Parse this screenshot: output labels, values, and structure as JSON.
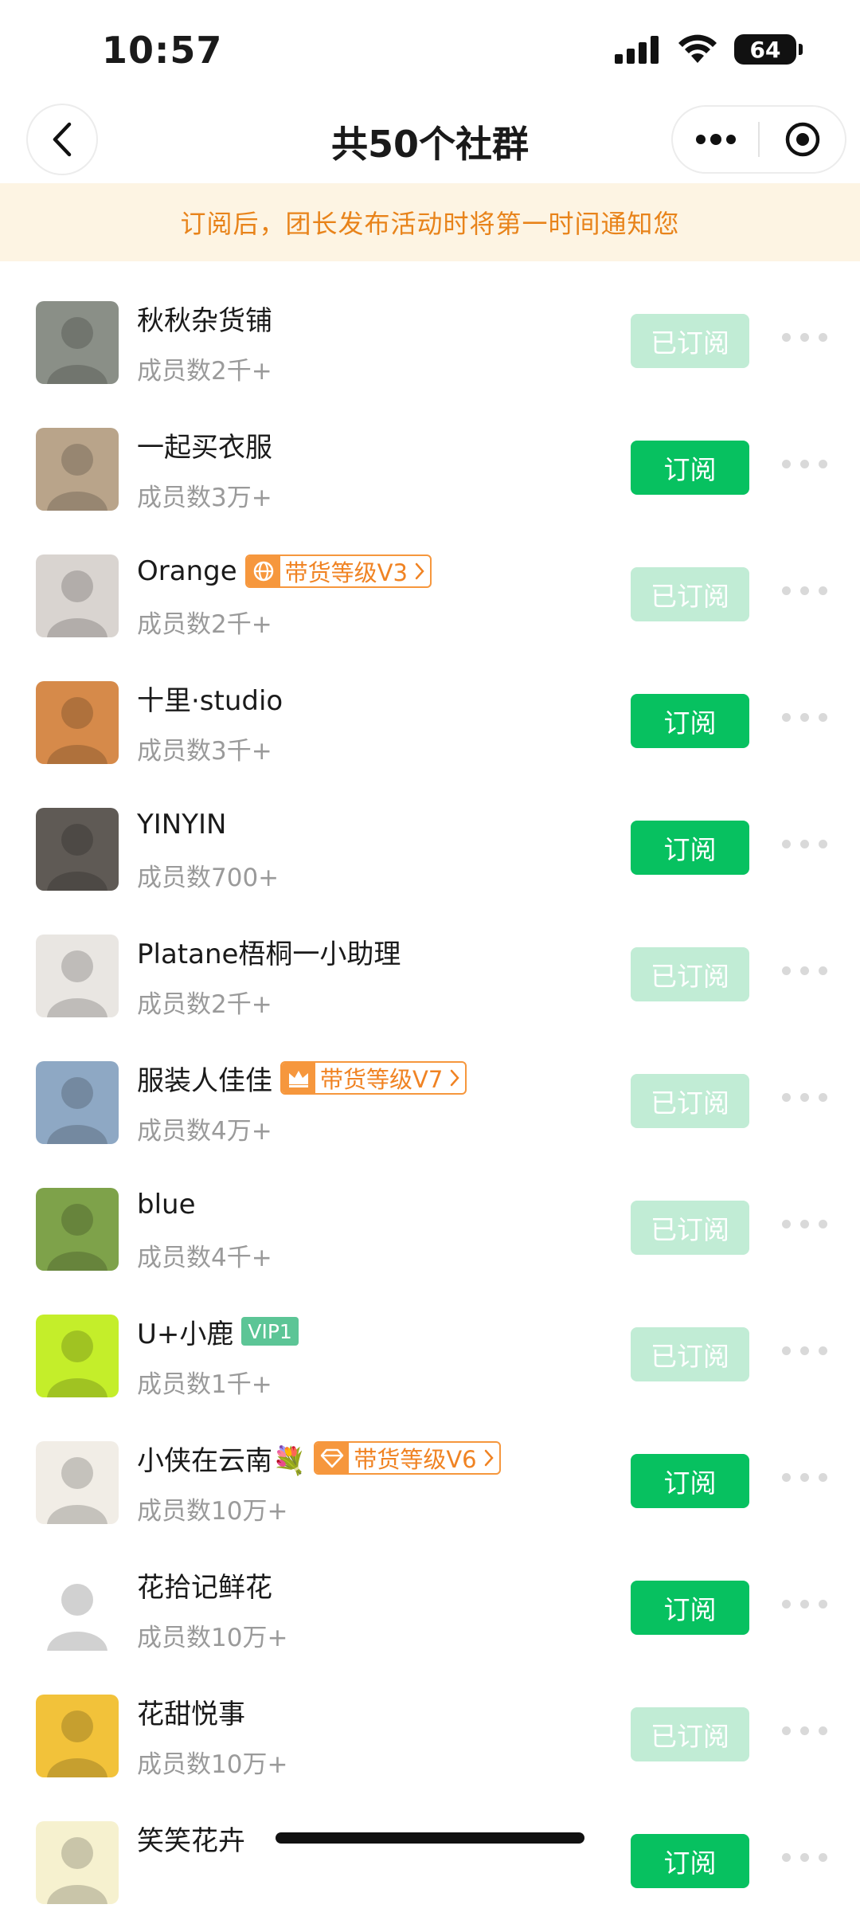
{
  "status": {
    "time": "10:57",
    "battery": "64"
  },
  "nav": {
    "title": "共50个社群"
  },
  "banner": {
    "text": "订阅后，团长发布活动时将第一时间通知您"
  },
  "labels": {
    "subscribe": "订阅",
    "subscribed": "已订阅"
  },
  "groups": [
    {
      "name": "秋秋杂货铺",
      "members": "成员数2千+",
      "subscribed": true,
      "avatar_color": "#8a8f87"
    },
    {
      "name": "一起买衣服",
      "members": "成员数3万+",
      "subscribed": false,
      "avatar_color": "#b9a48a"
    },
    {
      "name": "Orange",
      "members": "成员数2千+",
      "subscribed": true,
      "badge": "带货等级V3",
      "badge_icon": "globe-icon",
      "avatar_color": "#d9d4d0"
    },
    {
      "name": "十里·studio",
      "members": "成员数3千+",
      "subscribed": false,
      "avatar_color": "#d68a4a"
    },
    {
      "name": "YINYIN",
      "members": "成员数700+",
      "subscribed": false,
      "avatar_color": "#5f5a55"
    },
    {
      "name": "Platane梧桐一小助理",
      "members": "成员数2千+",
      "subscribed": true,
      "avatar_color": "#e9e6e2"
    },
    {
      "name": "服装人佳佳",
      "members": "成员数4万+",
      "subscribed": true,
      "badge": "带货等级V7",
      "badge_icon": "crown-icon",
      "avatar_color": "#8ea8c4"
    },
    {
      "name": "blue",
      "members": "成员数4千+",
      "subscribed": true,
      "avatar_color": "#7ea24a"
    },
    {
      "name": "U+小鹿",
      "members": "成员数1千+",
      "subscribed": true,
      "vip": "VIP1",
      "avatar_color": "#c4ee2a"
    },
    {
      "name": "小侠在云南💐",
      "members": "成员数10万+",
      "subscribed": false,
      "badge": "带货等级V6",
      "badge_icon": "diamond-icon",
      "avatar_color": "#f1ede6"
    },
    {
      "name": "花拾记鲜花",
      "members": "成员数10万+",
      "subscribed": false,
      "avatar_color": "#ffffff"
    },
    {
      "name": "花甜悦事",
      "members": "成员数10万+",
      "subscribed": true,
      "avatar_color": "#f2c23a"
    },
    {
      "name": "笑笑花卉",
      "members": "",
      "subscribed": false,
      "avatar_color": "#f6f1cf"
    }
  ]
}
